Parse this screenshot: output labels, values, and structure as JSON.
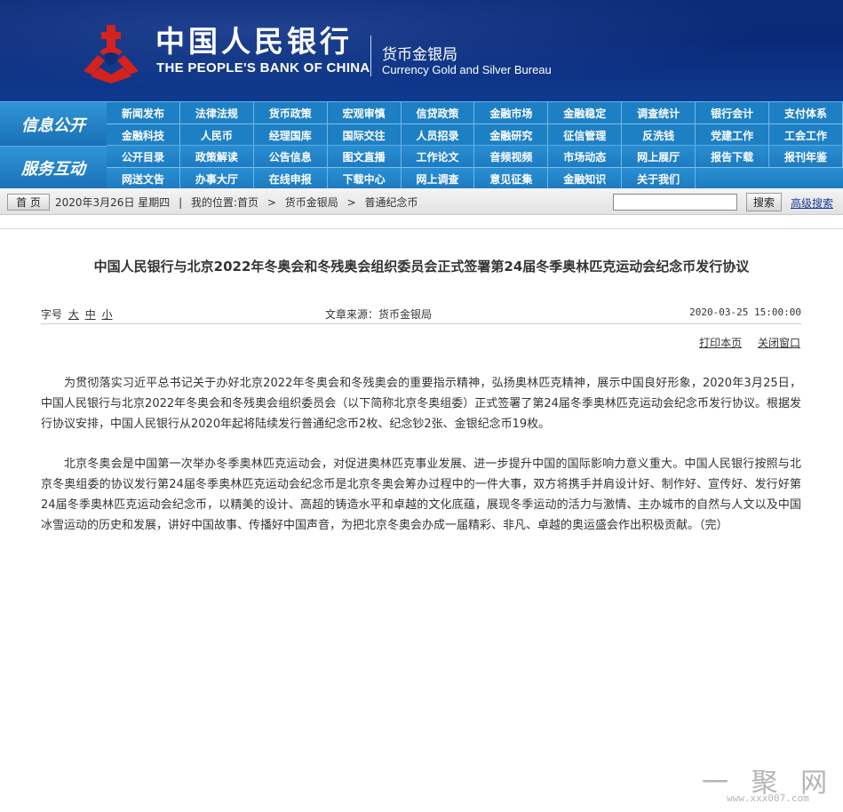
{
  "header": {
    "bank_cn": "中国人民银行",
    "bank_en": "THE PEOPLE'S BANK OF CHINA",
    "bureau_cn": "货币金银局",
    "bureau_en": "Currency  Gold and Silver Bureau",
    "logo_icon": "pboc-logo-icon",
    "colors": {
      "banner": "#0c2b78",
      "logo": "#d4221f",
      "nav": "#1e80c4"
    }
  },
  "nav": {
    "label_info": "信息公开",
    "label_service": "服务互动",
    "row1": [
      "新闻发布",
      "法律法规",
      "货币政策",
      "宏观审慎",
      "信贷政策",
      "金融市场",
      "金融稳定",
      "调查统计",
      "银行会计",
      "支付体系"
    ],
    "row2": [
      "金融科技",
      "人民币",
      "经理国库",
      "国际交往",
      "人员招录",
      "金融研究",
      "征信管理",
      "反洗钱",
      "党建工作",
      "工会工作"
    ],
    "row3": [
      "公开目录",
      "政策解读",
      "公告信息",
      "图文直播",
      "工作论文",
      "音频视频",
      "市场动态",
      "网上展厅",
      "报告下载",
      "报刊年鉴"
    ],
    "row4": [
      "网送文告",
      "办事大厅",
      "在线申报",
      "下载中心",
      "网上调查",
      "意见征集",
      "金融知识",
      "关于我们"
    ]
  },
  "breadcrumb": {
    "home_button": "首 页",
    "date": "2020年3月26日 星期四",
    "sep": "|",
    "location_label": "我的位置:首页",
    "arrow": ">",
    "level1": "货币金银局",
    "level2": "普通纪念币",
    "search_button": "搜索",
    "advanced_search": "高级搜索",
    "search_value": ""
  },
  "article": {
    "title": "中国人民银行与北京2022年冬奥会和冬残奥会组织委员会正式签署第24届冬季奥林匹克运动会纪念币发行协议",
    "font_label": "字号",
    "font_large": "大",
    "font_medium": "中",
    "font_small": "小",
    "source": "文章来源：货币金银局",
    "date": "2020-03-25 15:00:00",
    "print": "打印本页",
    "close": "关闭窗口",
    "paragraph1": "为贯彻落实习近平总书记关于办好北京2022年冬奥会和冬残奥会的重要指示精神，弘扬奥林匹克精神，展示中国良好形象，2020年3月25日，中国人民银行与北京2022年冬奥会和冬残奥会组织委员会（以下简称北京冬奥组委）正式签署了第24届冬季奥林匹克运动会纪念币发行协议。根据发行协议安排，中国人民银行从2020年起将陆续发行普通纪念币2枚、纪念钞2张、金银纪念币19枚。",
    "paragraph2": "北京冬奥会是中国第一次举办冬季奥林匹克运动会，对促进奥林匹克事业发展、进一步提升中国的国际影响力意义重大。中国人民银行按照与北京冬奥组委的协议发行第24届冬季奥林匹克运动会纪念币是北京冬奥会筹办过程中的一件大事，双方将携手并肩设计好、制作好、宣传好、发行好第24届冬季奥林匹克运动会纪念币，以精美的设计、高超的铸造水平和卓越的文化底蕴，展现冬季运动的活力与激情、主办城市的自然与人文以及中国冰雪运动的历史和发展，讲好中国故事、传播好中国声音，为把北京冬奥会办成一届精彩、非凡、卓越的奥运盛会作出积极贡献。（完）"
  },
  "watermark": {
    "big": "一 聚 网",
    "small": "www.xxx007.com"
  }
}
